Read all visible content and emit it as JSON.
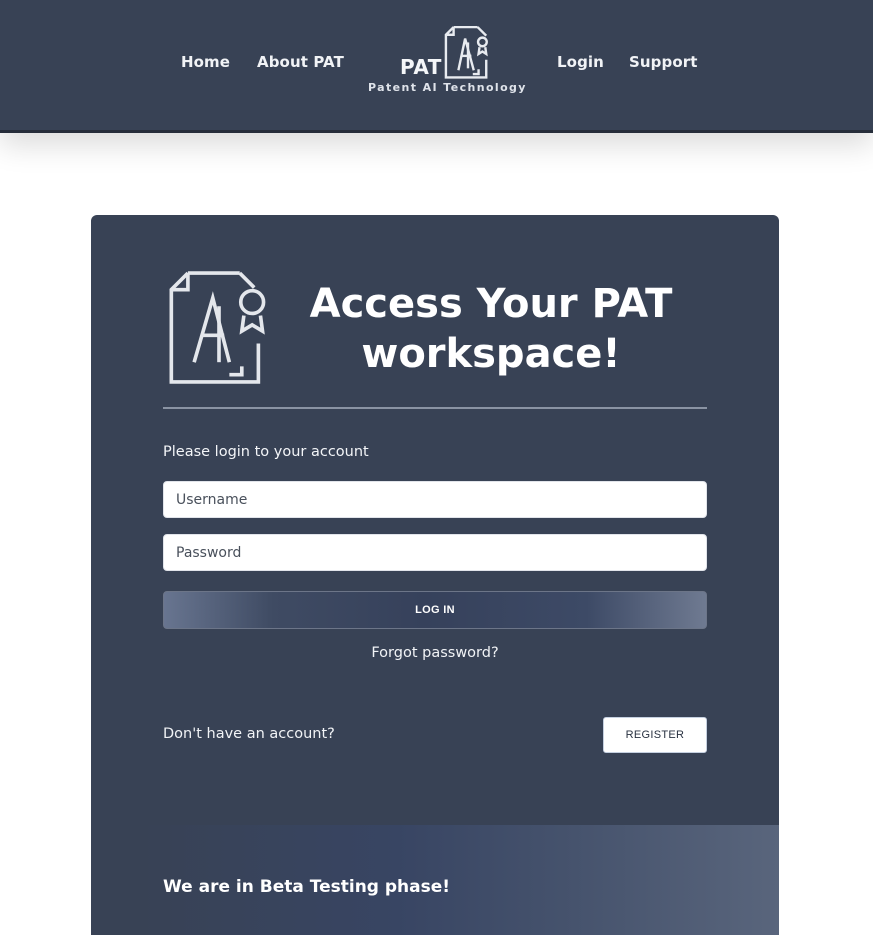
{
  "nav": {
    "items": [
      {
        "label": "Home"
      },
      {
        "label": "About PAT"
      },
      {
        "label": "Login"
      },
      {
        "label": "Support"
      }
    ],
    "brand": {
      "name": "PAT",
      "tagline": "Patent AI Technology"
    }
  },
  "login_card": {
    "title": "Access Your PAT workspace!",
    "prompt": "Please login to your account",
    "username_placeholder": "Username",
    "password_placeholder": "Password",
    "login_button": "LOG IN",
    "forgot_password": "Forgot password?",
    "no_account": "Don't have an account?",
    "register_button": "REGISTER",
    "beta_notice": "We are in Beta Testing phase!"
  },
  "colors": {
    "nav_background": "#384255",
    "card_background": "#384255",
    "text": "#ffffff"
  },
  "icons": [
    "patent-ai-logo-icon"
  ]
}
